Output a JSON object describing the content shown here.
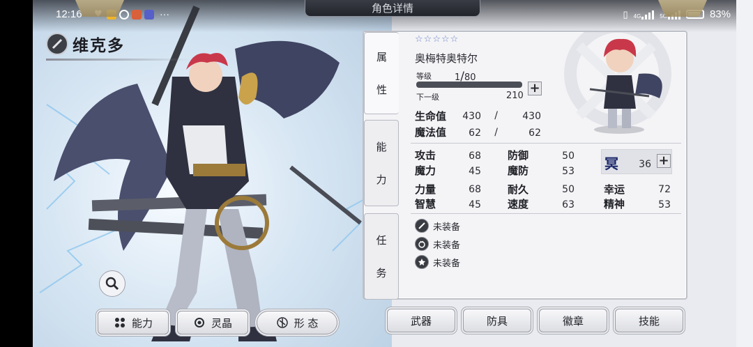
{
  "status_bar": {
    "time": "12:16",
    "notification_dots": "···",
    "network_4g": "4G",
    "network_5g": "5G",
    "battery": "83%"
  },
  "header": {
    "title": "角色详情"
  },
  "character": {
    "name": "维克多",
    "stars": [
      "☆",
      "☆",
      "☆",
      "☆",
      "☆"
    ],
    "race": "奥梅特奥特尔"
  },
  "tabs": [
    {
      "label_top": "属",
      "label_bottom": "性"
    },
    {
      "label_top": "能",
      "label_bottom": "力"
    },
    {
      "label_top": "任",
      "label_bottom": "务"
    }
  ],
  "level": {
    "label": "等级",
    "current": "1",
    "separator": "/",
    "max": "80",
    "progress_fraction": 0.0,
    "next_label": "下一级",
    "next_exp": "210",
    "plus": "+"
  },
  "vitals": [
    {
      "label": "生命值",
      "current": "430",
      "separator": "/",
      "max": "430"
    },
    {
      "label": "魔法值",
      "current": "62",
      "separator": "/",
      "max": "62"
    }
  ],
  "stats_col1": [
    {
      "label": "攻击",
      "value": "68"
    },
    {
      "label": "魔力",
      "value": "45"
    },
    {
      "label": "力量",
      "value": "68"
    },
    {
      "label": "智慧",
      "value": "45"
    }
  ],
  "stats_col2": [
    {
      "label": "防御",
      "value": "50"
    },
    {
      "label": "魔防",
      "value": "53"
    },
    {
      "label": "耐久",
      "value": "50"
    },
    {
      "label": "速度",
      "value": "63"
    }
  ],
  "stats_col3": [
    {
      "label": "幸运",
      "value": "72"
    },
    {
      "label": "精神",
      "value": "53"
    }
  ],
  "special": {
    "glyph": "冥",
    "value": "36",
    "plus": "+"
  },
  "equipment": [
    {
      "icon": "sword-icon",
      "label": "未装备"
    },
    {
      "icon": "armor-icon",
      "label": "未装备"
    },
    {
      "icon": "badge-icon",
      "label": "未装备"
    }
  ],
  "bottom_left_buttons": [
    {
      "icon": "grid-icon",
      "label": "能力"
    },
    {
      "icon": "crystal-icon",
      "label": "灵晶"
    },
    {
      "icon": "form-icon",
      "label": "形 态"
    }
  ],
  "bottom_right_buttons": [
    {
      "label": "武器"
    },
    {
      "label": "防具"
    },
    {
      "label": "徽章"
    },
    {
      "label": "技能"
    }
  ],
  "colors": {
    "panel_bg": "#f4f4f6",
    "star": "#6b82c9",
    "dark_ui": "#2d2f36"
  }
}
